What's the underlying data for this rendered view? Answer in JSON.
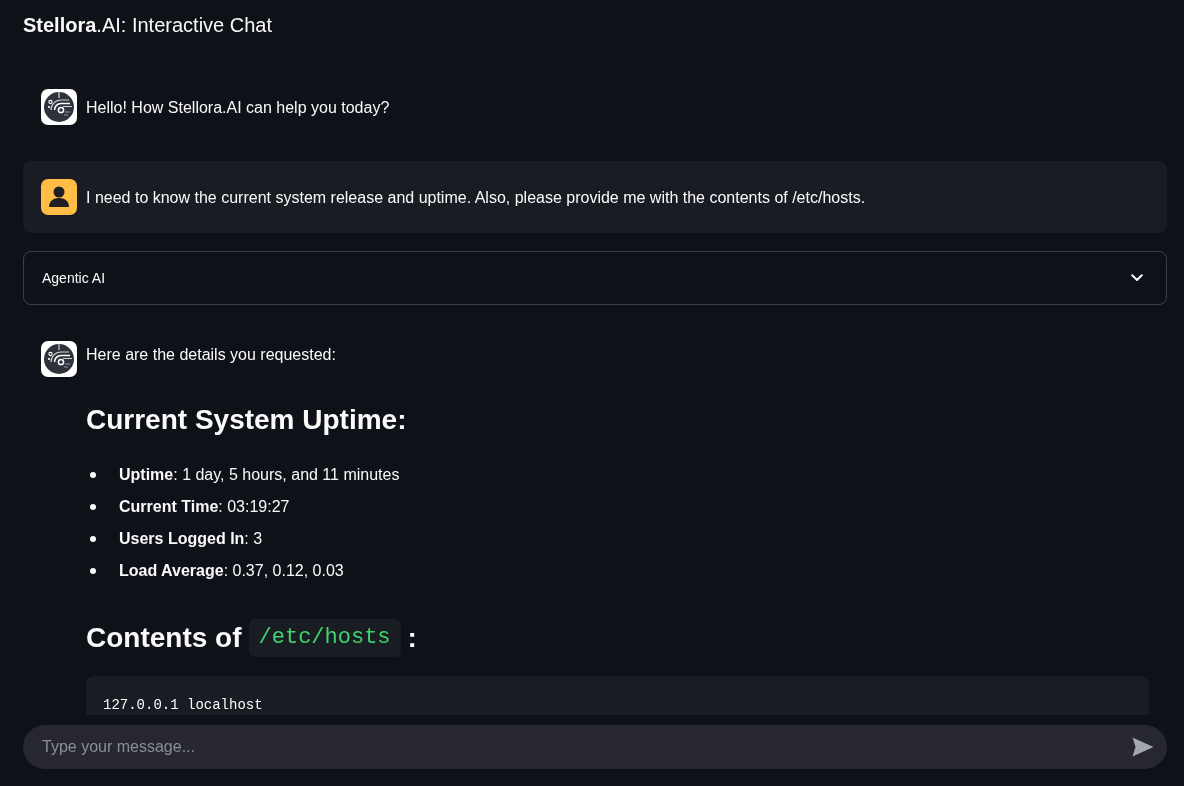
{
  "header": {
    "title": "**Stellora**.AI: Interactive Chat"
  },
  "conversation": [
    {
      "kind": "assistant",
      "blocks": [
        {
          "kind": "paragraph",
          "text": "Hello! How Stellora.AI can help you today?"
        }
      ]
    },
    {
      "kind": "user",
      "blocks": [
        {
          "kind": "paragraph",
          "text": "I need to know the current system release and uptime. Also, please provide me with the contents of /etc/hosts."
        }
      ]
    },
    {
      "kind": "expander",
      "label": "Agentic AI",
      "expanded": false
    },
    {
      "kind": "assistant",
      "blocks": [
        {
          "kind": "paragraph",
          "text": "Here are the details you requested:"
        },
        {
          "kind": "heading",
          "parts": [
            {
              "kind": "text",
              "text": "Current System Uptime:"
            }
          ]
        },
        {
          "kind": "list",
          "items": [
            "**Uptime**: 1 day, 5 hours, and 11 minutes",
            "**Current Time**: 03:19:27",
            "**Users Logged In**: 3",
            "**Load Average**: 0.37, 0.12, 0.03"
          ]
        },
        {
          "kind": "heading",
          "parts": [
            {
              "kind": "text",
              "text": "Contents of"
            },
            {
              "kind": "code",
              "text": "/etc/hosts"
            },
            {
              "kind": "text",
              "text": ":"
            }
          ]
        },
        {
          "kind": "code_block",
          "lines": [
            "127.0.0.1 localhost"
          ]
        }
      ]
    }
  ],
  "chat_input": {
    "placeholder": "Type your message..."
  }
}
